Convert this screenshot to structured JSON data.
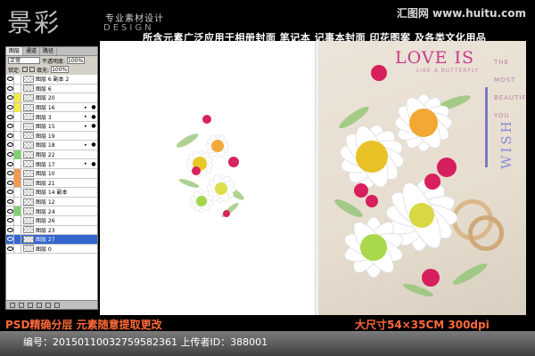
{
  "branding": {
    "logo_main": "景彩",
    "logo_sub": "专业素材设计",
    "logo_en": "DESIGN",
    "site_name": "汇图网",
    "site_url": "www.huitu.com"
  },
  "header": {
    "description": "所含元素广泛应用于相册封面  笔记本  记事本封面  印花图案  及各类文化用品"
  },
  "layers_panel": {
    "tabs": [
      "图层",
      "通道",
      "路径"
    ],
    "blend_mode": "正常",
    "opacity_label": "不透明度:",
    "opacity_value": "100%",
    "lock_label": "锁定:",
    "fill_label": "填充:",
    "fill_value": "100%",
    "layers": [
      {
        "name": "图层 6 副本 2",
        "color": "none",
        "fx": false,
        "selected": false
      },
      {
        "name": "图层 6",
        "color": "none",
        "fx": false,
        "selected": false
      },
      {
        "name": "图层 20",
        "color": "yellow",
        "fx": false,
        "selected": false
      },
      {
        "name": "图层 16",
        "color": "yellow",
        "fx": true,
        "selected": false
      },
      {
        "name": "图层 3",
        "color": "none",
        "fx": true,
        "selected": false
      },
      {
        "name": "图层 15",
        "color": "none",
        "fx": true,
        "selected": false
      },
      {
        "name": "图层 19",
        "color": "none",
        "fx": false,
        "selected": false
      },
      {
        "name": "图层 18",
        "color": "none",
        "fx": true,
        "selected": false
      },
      {
        "name": "图层 22",
        "color": "green",
        "fx": false,
        "selected": false
      },
      {
        "name": "图层 17",
        "color": "none",
        "fx": true,
        "selected": false
      },
      {
        "name": "图层 10",
        "color": "orange",
        "fx": false,
        "selected": false
      },
      {
        "name": "图层 21",
        "color": "orange",
        "fx": false,
        "selected": false
      },
      {
        "name": "图层 14 副本",
        "color": "none",
        "fx": false,
        "selected": false
      },
      {
        "name": "图层 12",
        "color": "none",
        "fx": false,
        "selected": false
      },
      {
        "name": "图层 24",
        "color": "green",
        "fx": false,
        "selected": false
      },
      {
        "name": "图层 26",
        "color": "none",
        "fx": false,
        "selected": false
      },
      {
        "name": "图层 23",
        "color": "none",
        "fx": false,
        "selected": false
      },
      {
        "name": "图层 27",
        "color": "none",
        "fx": false,
        "selected": true
      },
      {
        "name": "图层 0",
        "color": "none",
        "fx": false,
        "selected": false
      }
    ]
  },
  "cover": {
    "title": "LOVE IS",
    "subtitle": "LIKE A BUTTERFLY",
    "side_lines": [
      "THE",
      "MOST",
      "BEAUTIFUL",
      "YOU"
    ],
    "vertical_word": "WISH"
  },
  "bottom": {
    "left_caption": "PSD精确分层  元素随意提取更改",
    "right_caption": "大尺寸54×35CM   300dpi",
    "footer_id": "编号：20150110032759582361 上传者ID：388001"
  },
  "colors": {
    "accent_pink": "#c83a8a",
    "accent_violet": "#8c8ad6",
    "caption_orange": "#ff6a3a"
  }
}
